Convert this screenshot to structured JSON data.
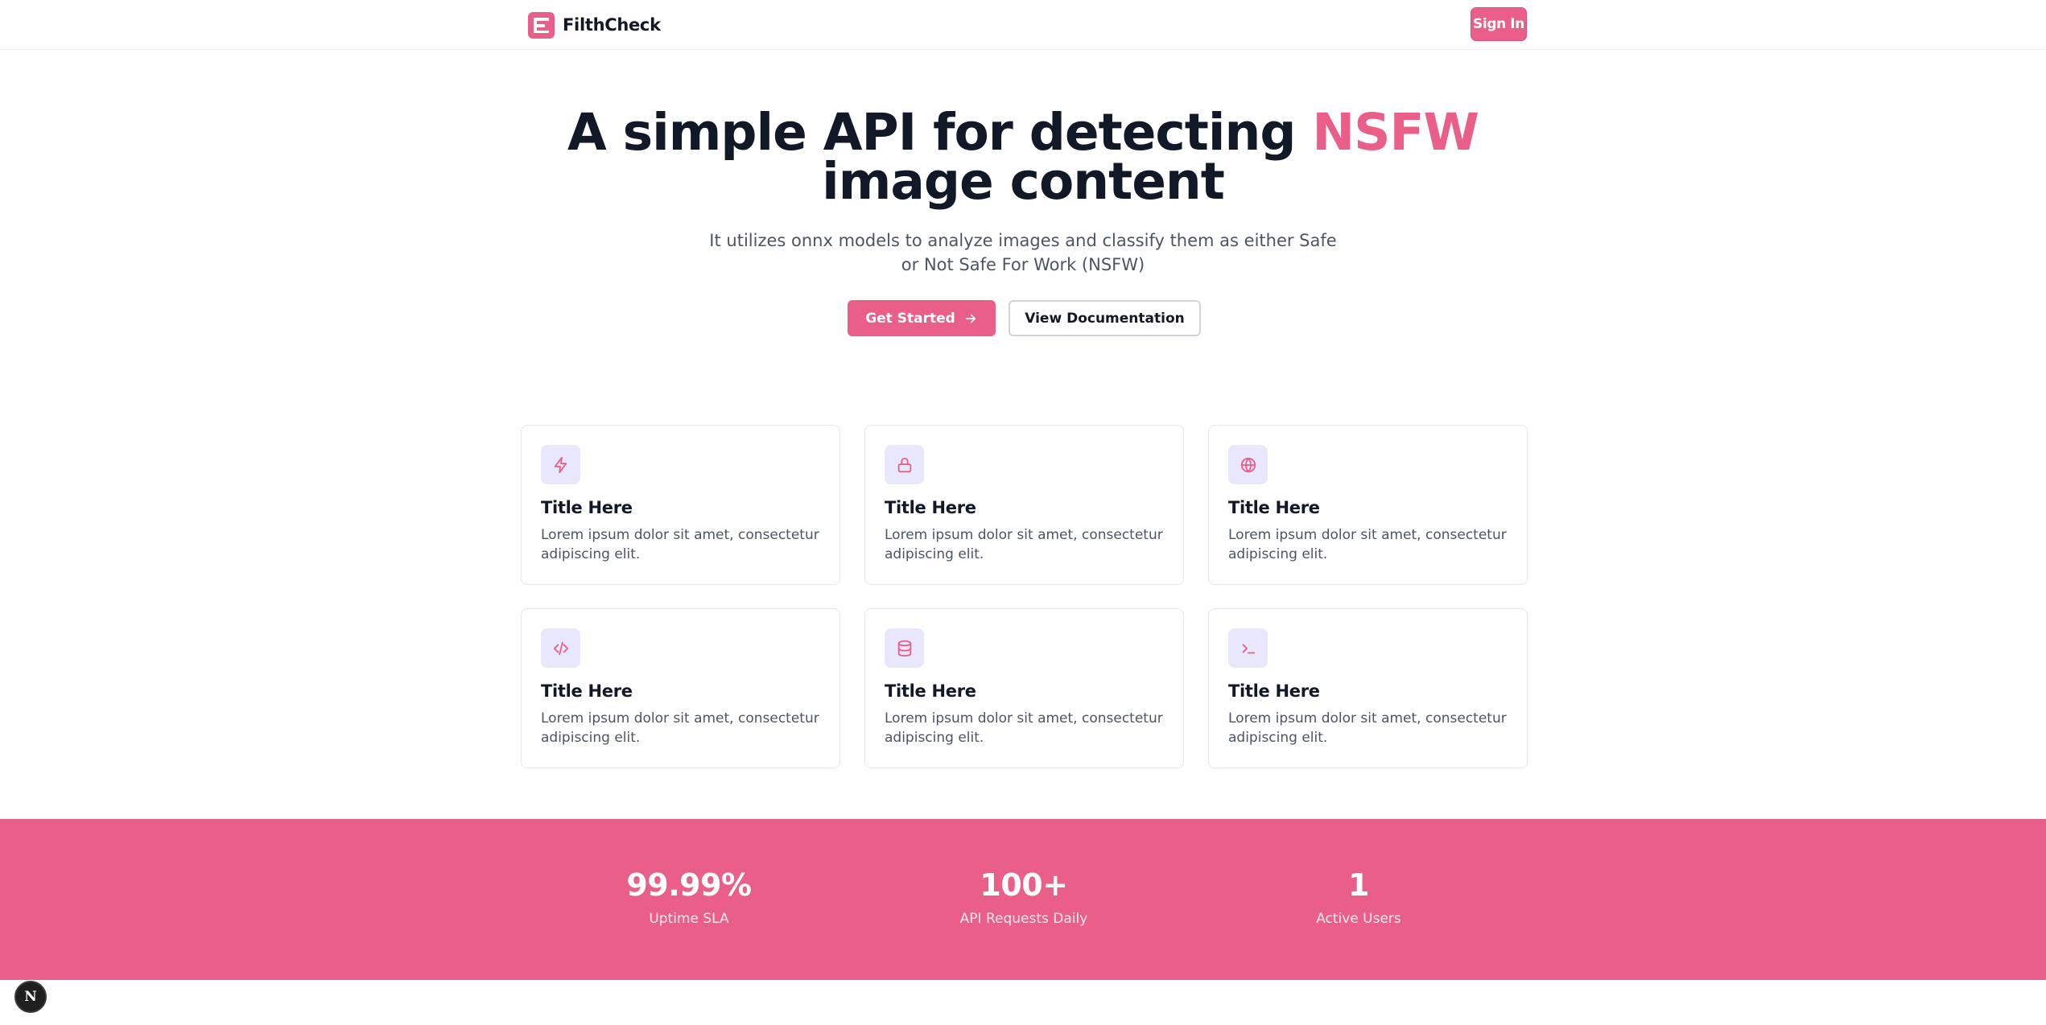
{
  "navbar": {
    "brand": "FilthCheck",
    "logo_icon": "filthcheck-logo-icon",
    "signin_label": "Sign In"
  },
  "hero": {
    "title_before": "A simple API for detecting ",
    "title_accent": "NSFW",
    "title_after": " image content",
    "subtitle": "It utilizes onnx models to analyze images and classify them as either Safe or Not Safe For Work (NSFW)",
    "primary_button": "Get Started",
    "primary_button_icon": "arrow-right-icon",
    "secondary_button": "View Documentation"
  },
  "features": [
    {
      "icon": "zap-icon",
      "title": "Title Here",
      "text": "Lorem ipsum dolor sit amet, consectetur adipiscing elit."
    },
    {
      "icon": "lock-icon",
      "title": "Title Here",
      "text": "Lorem ipsum dolor sit amet, consectetur adipiscing elit."
    },
    {
      "icon": "globe-icon",
      "title": "Title Here",
      "text": "Lorem ipsum dolor sit amet, consectetur adipiscing elit."
    },
    {
      "icon": "code-icon",
      "title": "Title Here",
      "text": "Lorem ipsum dolor sit amet, consectetur adipiscing elit."
    },
    {
      "icon": "database-icon",
      "title": "Title Here",
      "text": "Lorem ipsum dolor sit amet, consectetur adipiscing elit."
    },
    {
      "icon": "terminal-icon",
      "title": "Title Here",
      "text": "Lorem ipsum dolor sit amet, consectetur adipiscing elit."
    }
  ],
  "stats": [
    {
      "value": "99.99%",
      "label": "Uptime SLA"
    },
    {
      "value": "100+",
      "label": "API Requests Daily"
    },
    {
      "value": "1",
      "label": "Active Users"
    }
  ],
  "dev_badge": {
    "letter": "N",
    "icon": "nextjs-badge-icon"
  },
  "colors": {
    "accent": "#ea5f87",
    "text_dark": "#111827",
    "text_muted": "#4b5563",
    "icon_bg": "#e9e7fb",
    "border": "#e5e7eb"
  }
}
